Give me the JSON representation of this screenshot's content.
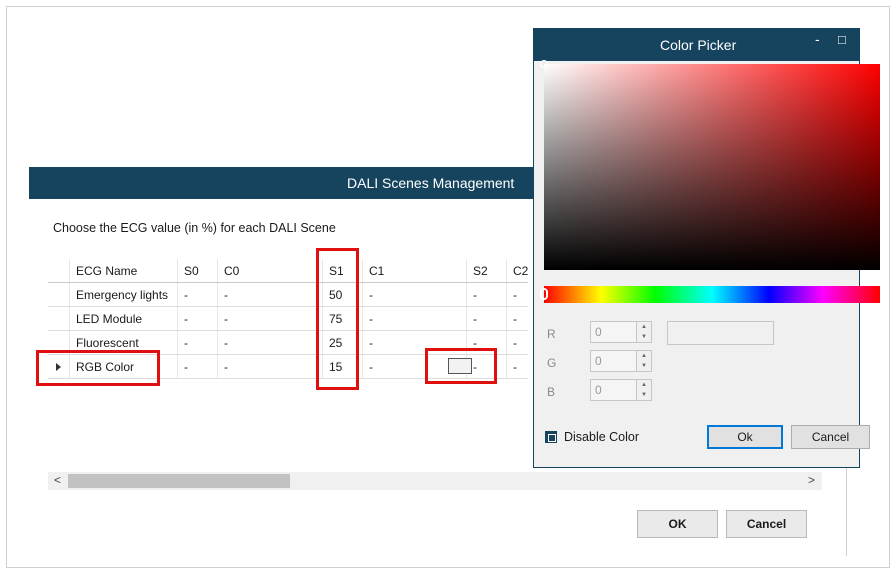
{
  "dali": {
    "title": "DALI Scenes Management",
    "subtitle": "Choose the ECG value (in %) for each DALI Scene",
    "columns": [
      "ECG Name",
      "S0",
      "C0",
      "S1",
      "C1",
      "S2",
      "C2"
    ],
    "rows": [
      {
        "name": "Emergency lights",
        "s0": "-",
        "c0": "-",
        "s1": "50",
        "c1": "-",
        "s2": "-",
        "c2": "-"
      },
      {
        "name": "LED Module",
        "s0": "-",
        "c0": "-",
        "s1": "75",
        "c1": "-",
        "s2": "-",
        "c2": "-"
      },
      {
        "name": "Fluorescent",
        "s0": "-",
        "c0": "-",
        "s1": "25",
        "c1": "-",
        "s2": "-",
        "c2": "-"
      },
      {
        "name": "RGB Color",
        "s0": "-",
        "c0": "-",
        "s1": "15",
        "c1": "-",
        "s2": "-",
        "c2": "-"
      }
    ],
    "ok_label": "OK",
    "cancel_label": "Cancel",
    "scroll_left": "<",
    "scroll_right": ">"
  },
  "color_picker": {
    "title": "Color Picker",
    "minimize": "-",
    "maximize": "□",
    "close": "✕",
    "r_label": "R",
    "g_label": "G",
    "b_label": "B",
    "r_value": "0",
    "g_value": "0",
    "b_value": "0",
    "disable_label": "Disable Color",
    "ok_label": "Ok",
    "cancel_label": "Cancel"
  },
  "highlight_color": "#e01010",
  "accent_color": "#16445f"
}
